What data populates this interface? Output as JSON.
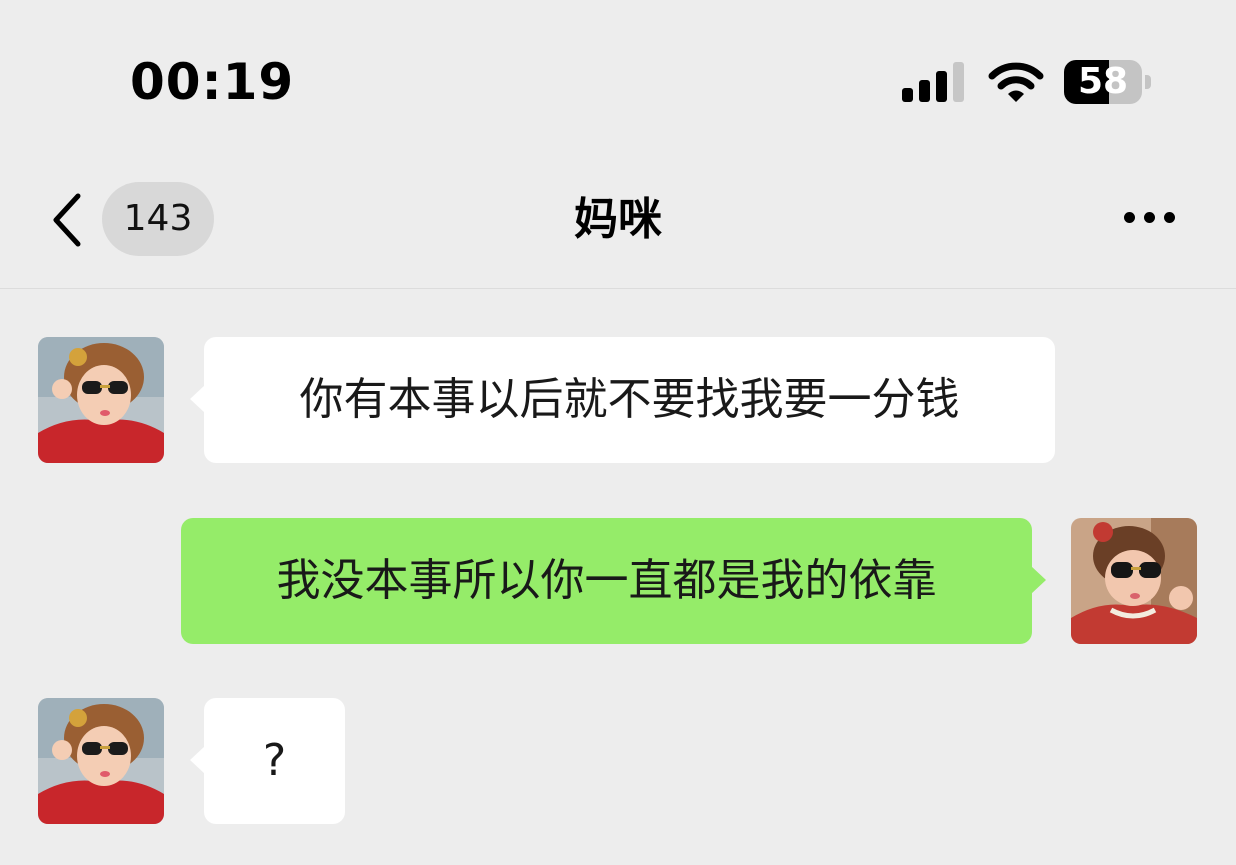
{
  "status_bar": {
    "time": "00:19",
    "battery_level": "58",
    "signal_icon": "cellular-signal-icon",
    "wifi_icon": "wifi-icon",
    "battery_icon": "battery-icon"
  },
  "nav": {
    "back_icon": "chevron-left-icon",
    "unread_count": "143",
    "title": "妈咪",
    "more_icon": "more-dots-icon"
  },
  "messages": [
    {
      "direction": "incoming",
      "text": "你有本事以后就不要找我要一分钱"
    },
    {
      "direction": "outgoing",
      "text": "我没本事所以你一直都是我的依靠"
    },
    {
      "direction": "incoming",
      "text": "?"
    }
  ],
  "colors": {
    "background": "#ededed",
    "incoming_bubble": "#ffffff",
    "outgoing_bubble": "#95ec69",
    "unread_badge": "#d8d8d8"
  }
}
